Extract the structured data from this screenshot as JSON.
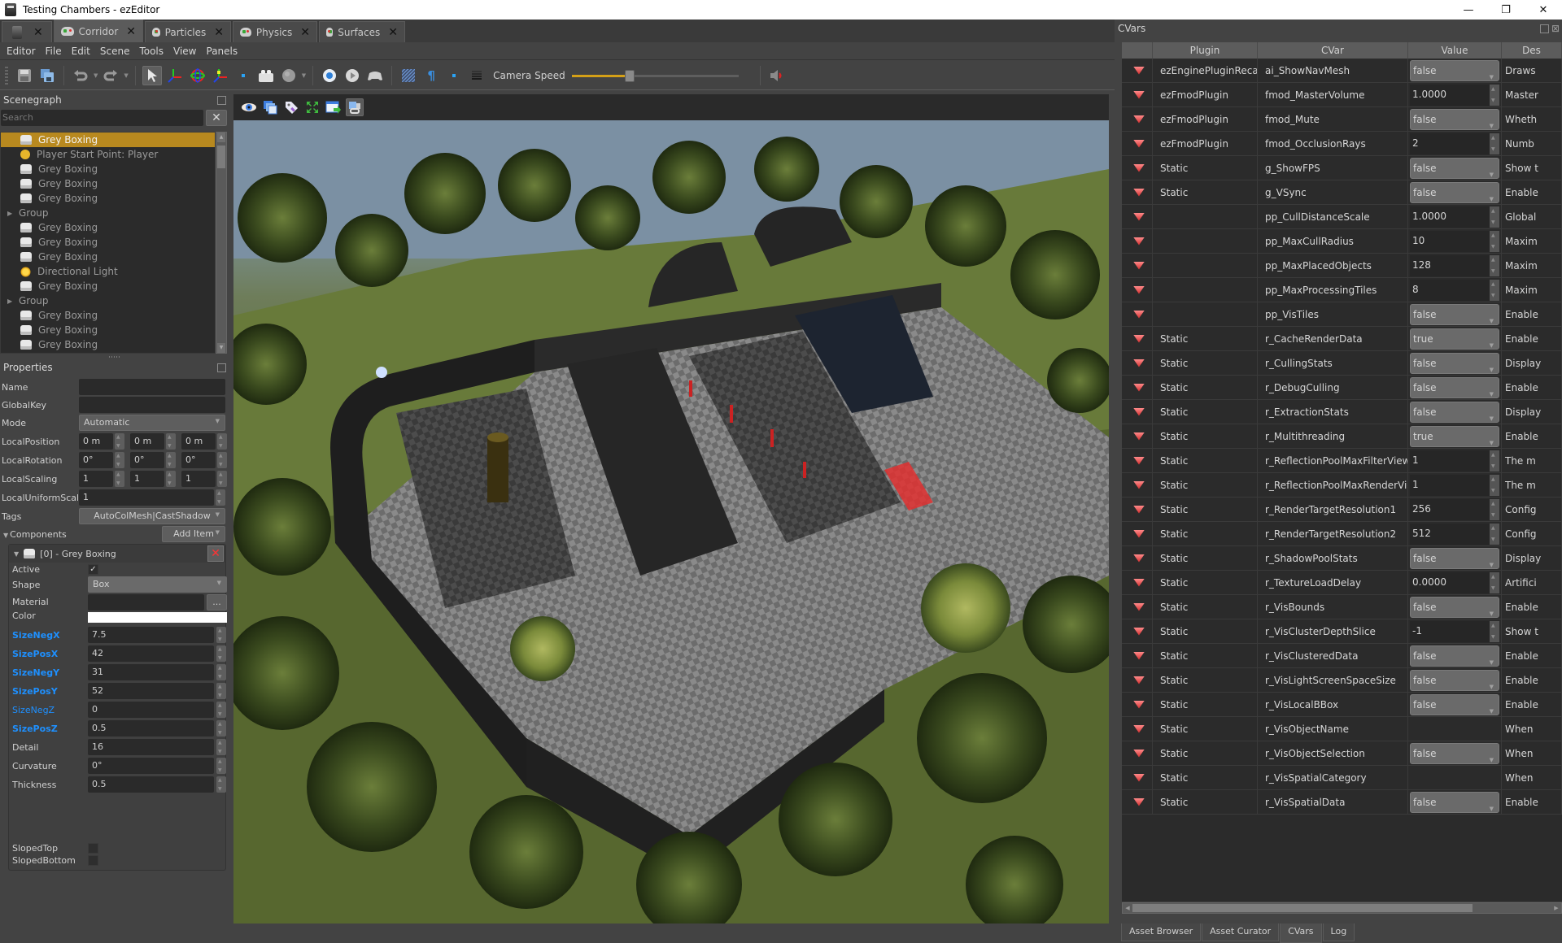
{
  "window": {
    "title": "Testing Chambers - ezEditor",
    "controls": {
      "minimize": "—",
      "maximize": "❐",
      "close": "✕"
    }
  },
  "doc_tabs": [
    {
      "label": "",
      "icon": "ez-editor-icon",
      "active": false
    },
    {
      "label": "Corridor",
      "icon": "gamepad-icon",
      "active": true
    },
    {
      "label": "Particles",
      "icon": "gamepad-icon",
      "active": false
    },
    {
      "label": "Physics",
      "icon": "gamepad-icon",
      "active": false
    },
    {
      "label": "Surfaces",
      "icon": "gamepad-icon",
      "active": false
    }
  ],
  "menu": [
    "Editor",
    "File",
    "Edit",
    "Scene",
    "Tools",
    "View",
    "Panels"
  ],
  "toolbar": {
    "camera_speed_label": "Camera Speed",
    "camera_speed_fraction": 0.35,
    "accent_color": "#d4a017"
  },
  "scenegraph": {
    "title": "Scenegraph",
    "search_placeholder": "Search",
    "items": [
      {
        "label": "Grey Boxing",
        "icon": "box",
        "type": "node",
        "selected": true
      },
      {
        "label": "Player Start Point: Player",
        "icon": "smile",
        "type": "node"
      },
      {
        "label": "Grey Boxing",
        "icon": "box",
        "type": "node"
      },
      {
        "label": "Grey Boxing",
        "icon": "box",
        "type": "node"
      },
      {
        "label": "Grey Boxing",
        "icon": "box",
        "type": "node"
      },
      {
        "label": "Group",
        "icon": "",
        "type": "group"
      },
      {
        "label": "Grey Boxing",
        "icon": "box",
        "type": "node"
      },
      {
        "label": "Grey Boxing",
        "icon": "box",
        "type": "node"
      },
      {
        "label": "Grey Boxing",
        "icon": "box",
        "type": "node"
      },
      {
        "label": "Directional Light",
        "icon": "sun",
        "type": "node"
      },
      {
        "label": "Grey Boxing",
        "icon": "box",
        "type": "node"
      },
      {
        "label": "Group",
        "icon": "",
        "type": "group"
      },
      {
        "label": "Grey Boxing",
        "icon": "box",
        "type": "node"
      },
      {
        "label": "Grey Boxing",
        "icon": "box",
        "type": "node"
      },
      {
        "label": "Grey Boxing",
        "icon": "box",
        "type": "node"
      }
    ],
    "selected_color": "#b8891f"
  },
  "properties": {
    "title": "Properties",
    "name_label": "Name",
    "name_value": "",
    "globalkey_label": "GlobalKey",
    "globalkey_value": "",
    "mode_label": "Mode",
    "mode_value": "Automatic",
    "localposition_label": "LocalPosition",
    "localposition": [
      "0 m",
      "0 m",
      "0 m"
    ],
    "localrotation_label": "LocalRotation",
    "localrotation": [
      "0°",
      "0°",
      "0°"
    ],
    "localscaling_label": "LocalScaling",
    "localscaling": [
      "1",
      "1",
      "1"
    ],
    "localuniformscaling_label": "LocalUniformScaling",
    "localuniformscaling": "1",
    "tags_label": "Tags",
    "tags_value": "AutoColMesh|CastShadow",
    "components_label": "Components",
    "add_item_label": "Add Item",
    "component": {
      "title": "[0] - Grey Boxing",
      "active_label": "Active",
      "active": true,
      "shape_label": "Shape",
      "shape_value": "Box",
      "material_label": "Material",
      "material_value": "",
      "material_browse": "...",
      "color_label": "Color",
      "color_value": "#ffffff",
      "fields": [
        {
          "label": "SizeNegX",
          "value": "7.5",
          "style": "bold-blue"
        },
        {
          "label": "SizePosX",
          "value": "42",
          "style": "bold-blue"
        },
        {
          "label": "SizeNegY",
          "value": "31",
          "style": "bold-blue"
        },
        {
          "label": "SizePosY",
          "value": "52",
          "style": "bold-blue"
        },
        {
          "label": "SizeNegZ",
          "value": "0",
          "style": "blue"
        },
        {
          "label": "SizePosZ",
          "value": "0.5",
          "style": "bold-blue"
        },
        {
          "label": "Detail",
          "value": "16",
          "style": "normal"
        },
        {
          "label": "Curvature",
          "value": "0°",
          "style": "normal"
        },
        {
          "label": "Thickness",
          "value": "0.5",
          "style": "normal"
        }
      ],
      "sloped_top_label": "SlopedTop",
      "sloped_top": false,
      "sloped_bottom_label": "SlopedBottom",
      "sloped_bottom": false
    },
    "modified_color": "#1e90ff"
  },
  "cvars": {
    "title": "CVars",
    "columns": [
      "",
      "Plugin",
      "CVar",
      "Value",
      "Des"
    ],
    "rows": [
      {
        "plugin": "ezEnginePluginRecast",
        "cvar": "ai_ShowNavMesh",
        "value": "false",
        "kind": "combo",
        "desc": "Draws"
      },
      {
        "plugin": "ezFmodPlugin",
        "cvar": "fmod_MasterVolume",
        "value": "1.0000",
        "kind": "spin",
        "desc": "Master"
      },
      {
        "plugin": "ezFmodPlugin",
        "cvar": "fmod_Mute",
        "value": "false",
        "kind": "combo",
        "desc": "Wheth"
      },
      {
        "plugin": "ezFmodPlugin",
        "cvar": "fmod_OcclusionRays",
        "value": "2",
        "kind": "spin",
        "desc": "Numb"
      },
      {
        "plugin": "Static",
        "cvar": "g_ShowFPS",
        "value": "false",
        "kind": "combo",
        "desc": "Show t"
      },
      {
        "plugin": "Static",
        "cvar": "g_VSync",
        "value": "false",
        "kind": "combo",
        "desc": "Enable"
      },
      {
        "plugin": "",
        "cvar": "pp_CullDistanceScale",
        "value": "1.0000",
        "kind": "spin",
        "desc": "Global"
      },
      {
        "plugin": "",
        "cvar": "pp_MaxCullRadius",
        "value": "10",
        "kind": "spin",
        "desc": "Maxim"
      },
      {
        "plugin": "",
        "cvar": "pp_MaxPlacedObjects",
        "value": "128",
        "kind": "spin",
        "desc": "Maxim"
      },
      {
        "plugin": "",
        "cvar": "pp_MaxProcessingTiles",
        "value": "8",
        "kind": "spin",
        "desc": "Maxim"
      },
      {
        "plugin": "",
        "cvar": "pp_VisTiles",
        "value": "false",
        "kind": "combo",
        "desc": "Enable"
      },
      {
        "plugin": "Static",
        "cvar": "r_CacheRenderData",
        "value": "true",
        "kind": "combo",
        "desc": "Enable"
      },
      {
        "plugin": "Static",
        "cvar": "r_CullingStats",
        "value": "false",
        "kind": "combo",
        "desc": "Display"
      },
      {
        "plugin": "Static",
        "cvar": "r_DebugCulling",
        "value": "false",
        "kind": "combo",
        "desc": "Enable"
      },
      {
        "plugin": "Static",
        "cvar": "r_ExtractionStats",
        "value": "false",
        "kind": "combo",
        "desc": "Display"
      },
      {
        "plugin": "Static",
        "cvar": "r_Multithreading",
        "value": "true",
        "kind": "combo",
        "desc": "Enable"
      },
      {
        "plugin": "Static",
        "cvar": "r_ReflectionPoolMaxFilterViews",
        "value": "1",
        "kind": "spin",
        "desc": "The m"
      },
      {
        "plugin": "Static",
        "cvar": "r_ReflectionPoolMaxRenderViews",
        "value": "1",
        "kind": "spin",
        "desc": "The m"
      },
      {
        "plugin": "Static",
        "cvar": "r_RenderTargetResolution1",
        "value": "256",
        "kind": "spin",
        "desc": "Config"
      },
      {
        "plugin": "Static",
        "cvar": "r_RenderTargetResolution2",
        "value": "512",
        "kind": "spin",
        "desc": "Config"
      },
      {
        "plugin": "Static",
        "cvar": "r_ShadowPoolStats",
        "value": "false",
        "kind": "combo",
        "desc": "Display"
      },
      {
        "plugin": "Static",
        "cvar": "r_TextureLoadDelay",
        "value": "0.0000",
        "kind": "spin",
        "desc": "Artifici"
      },
      {
        "plugin": "Static",
        "cvar": "r_VisBounds",
        "value": "false",
        "kind": "combo",
        "desc": "Enable"
      },
      {
        "plugin": "Static",
        "cvar": "r_VisClusterDepthSlice",
        "value": "-1",
        "kind": "spin",
        "desc": "Show t"
      },
      {
        "plugin": "Static",
        "cvar": "r_VisClusteredData",
        "value": "false",
        "kind": "combo",
        "desc": "Enable"
      },
      {
        "plugin": "Static",
        "cvar": "r_VisLightScreenSpaceSize",
        "value": "false",
        "kind": "combo",
        "desc": "Enable"
      },
      {
        "plugin": "Static",
        "cvar": "r_VisLocalBBox",
        "value": "false",
        "kind": "combo",
        "desc": "Enable"
      },
      {
        "plugin": "Static",
        "cvar": "r_VisObjectName",
        "value": "",
        "kind": "text",
        "desc": "When"
      },
      {
        "plugin": "Static",
        "cvar": "r_VisObjectSelection",
        "value": "false",
        "kind": "combo",
        "desc": "When"
      },
      {
        "plugin": "Static",
        "cvar": "r_VisSpatialCategory",
        "value": "",
        "kind": "text",
        "desc": "When"
      },
      {
        "plugin": "Static",
        "cvar": "r_VisSpatialData",
        "value": "false",
        "kind": "combo",
        "desc": "Enable"
      }
    ]
  },
  "bottom_tabs": [
    {
      "label": "Asset Browser",
      "active": false
    },
    {
      "label": "Asset Curator",
      "active": false
    },
    {
      "label": "CVars",
      "active": true
    },
    {
      "label": "Log",
      "active": false
    }
  ],
  "viewport": {
    "description": "3D perspective view of grey-boxed level with checkerboard walls surrounded by trees on grassy terrain"
  }
}
